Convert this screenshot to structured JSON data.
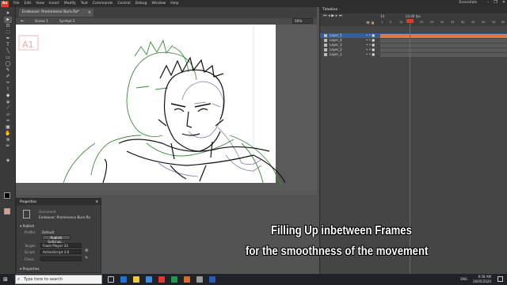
{
  "menubar": {
    "app_logo": "An",
    "items": [
      "File",
      "Edit",
      "View",
      "Insert",
      "Modify",
      "Text",
      "Commands",
      "Control",
      "Debug",
      "Window",
      "Help"
    ],
    "workspace": "Essentials",
    "window_controls": [
      "–",
      "❐",
      "✕"
    ]
  },
  "document": {
    "tab_title": "Endeavor: Prominence Burn.fla*",
    "tab_close": "×",
    "scene": "Scene 1",
    "symbol": "Symbol 2",
    "zoom": "50%",
    "stage_frame_label": "A1"
  },
  "properties": {
    "panel_title": "Properties",
    "doc_type": "Document",
    "doc_name": "Endeavor: Prominence Burn.fla",
    "section_publish": "Publish",
    "profile_label": "Profile:",
    "profile_value": "Default",
    "publish_settings_button": "Publish Settings...",
    "target_label": "Target:",
    "target_value": "Flash Player 32",
    "script_label": "Script:",
    "script_value": "ActionScript 3.0",
    "class_label": "Class:",
    "section_properties": "Properties"
  },
  "timeline": {
    "panel_title": "Timeline",
    "fps": "24.00 fps",
    "frame": "14",
    "ruler_ticks": [
      "1",
      "5",
      "10",
      "15",
      "20",
      "25",
      "30",
      "35",
      "40",
      "45",
      "50",
      "55",
      "60"
    ],
    "layers": [
      {
        "name": "Layer_5",
        "selected": true
      },
      {
        "name": "Layer_4",
        "selected": false
      },
      {
        "name": "Layer_3",
        "selected": false
      },
      {
        "name": "Layer_2",
        "selected": false
      },
      {
        "name": "Layer_1",
        "selected": false
      }
    ]
  },
  "caption": {
    "line1": "Filling Up inbetween Frames",
    "line2": "for the smoothness of the movement"
  },
  "taskbar": {
    "search_placeholder": "Type here to search",
    "time": "9:58 AM",
    "date": "26/05/2020",
    "language": "ENG"
  },
  "colors": {
    "accent": "#e0392b",
    "selected_layer": "#355e9a",
    "keyframe_span": "#e07a45",
    "sketch_green": "#3c8a3c",
    "sketch_purple": "#8a78b0"
  }
}
